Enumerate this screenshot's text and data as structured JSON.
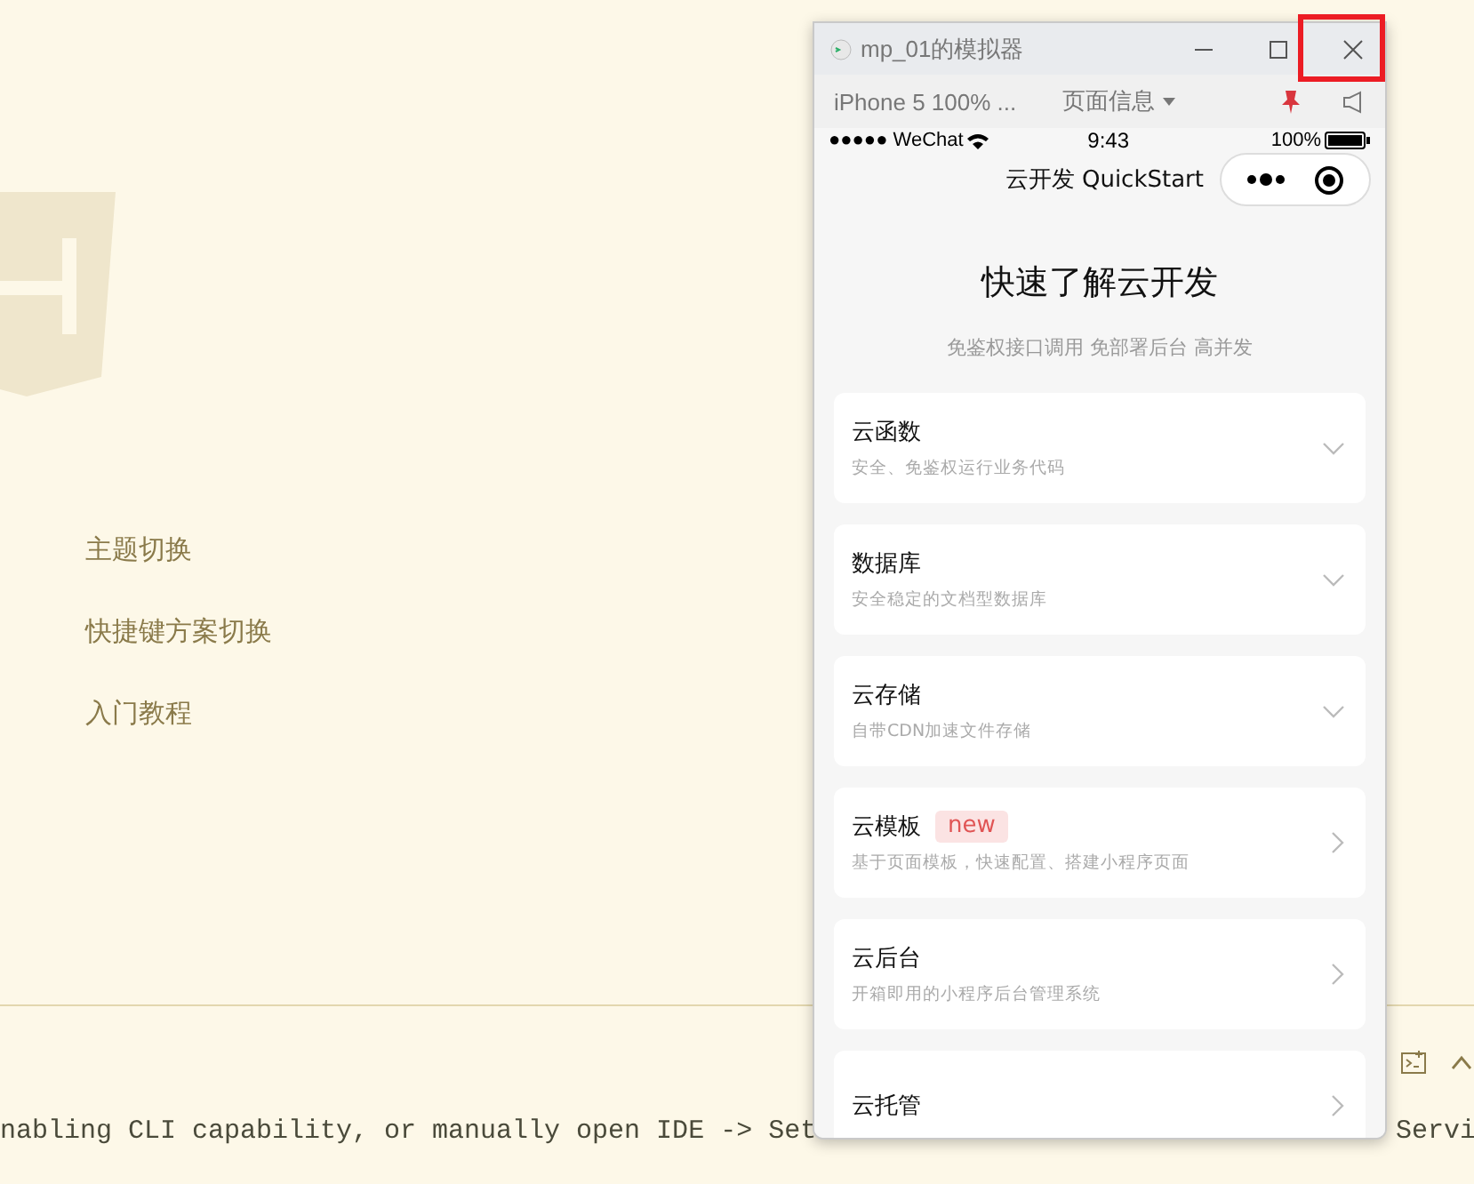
{
  "sidebar": {
    "items": [
      {
        "label": "主题切换"
      },
      {
        "label": "快捷键方案切换"
      },
      {
        "label": "入门教程"
      }
    ]
  },
  "console": {
    "text_left": "nabling CLI capability, or manually open IDE -> Set",
    "text_right": "Servi"
  },
  "simulator": {
    "title": "mp_01的模拟器",
    "device": "iPhone 5 100% ...",
    "page_info": "页面信息",
    "status_bar": {
      "carrier": "●●●●● WeChat",
      "time": "9:43",
      "battery": "100%"
    },
    "nav_title": "云开发 QuickStart",
    "heading": "快速了解云开发",
    "subheading": "免鉴权接口调用 免部署后台 高并发",
    "cards": [
      {
        "title": "云函数",
        "subtitle": "安全、免鉴权运行业务代码",
        "kind": "expand"
      },
      {
        "title": "数据库",
        "subtitle": "安全稳定的文档型数据库",
        "kind": "expand"
      },
      {
        "title": "云存储",
        "subtitle": "自带CDN加速文件存储",
        "kind": "expand"
      },
      {
        "title": "云模板",
        "badge": "new",
        "subtitle": "基于页面模板，快速配置、搭建小程序页面",
        "kind": "link"
      },
      {
        "title": "云后台",
        "subtitle": "开箱即用的小程序后台管理系统",
        "kind": "link"
      },
      {
        "title": "云托管",
        "kind": "link"
      }
    ]
  }
}
